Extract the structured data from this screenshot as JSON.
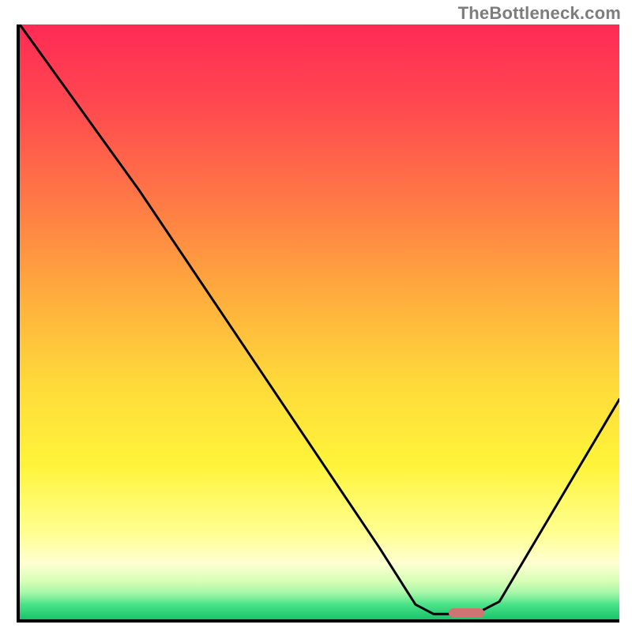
{
  "watermark": "TheBottleneck.com",
  "accent_marker_color": "#cf7373",
  "chart_data": {
    "type": "line",
    "title": "",
    "xlabel": "",
    "ylabel": "",
    "xlim": [
      0,
      100
    ],
    "ylim": [
      0,
      100
    ],
    "gradient_bands": [
      {
        "stop": 0.0,
        "color": "#ff2a55"
      },
      {
        "stop": 0.14,
        "color": "#ff4a4f"
      },
      {
        "stop": 0.3,
        "color": "#ff7a45"
      },
      {
        "stop": 0.46,
        "color": "#ffae3d"
      },
      {
        "stop": 0.6,
        "color": "#ffd93a"
      },
      {
        "stop": 0.74,
        "color": "#fff43a"
      },
      {
        "stop": 0.855,
        "color": "#ffff91"
      },
      {
        "stop": 0.905,
        "color": "#ffffd2"
      },
      {
        "stop": 0.935,
        "color": "#d8ffb8"
      },
      {
        "stop": 0.955,
        "color": "#a8f7a8"
      },
      {
        "stop": 0.975,
        "color": "#4be389"
      },
      {
        "stop": 1.0,
        "color": "#17c36a"
      }
    ],
    "curve": [
      {
        "x": 0.0,
        "y": 100.0
      },
      {
        "x": 20.0,
        "y": 72.0
      },
      {
        "x": 24.0,
        "y": 66.0
      },
      {
        "x": 40.0,
        "y": 42.0
      },
      {
        "x": 60.0,
        "y": 12.0
      },
      {
        "x": 66.0,
        "y": 2.5
      },
      {
        "x": 69.0,
        "y": 0.9
      },
      {
        "x": 76.0,
        "y": 0.9
      },
      {
        "x": 80.0,
        "y": 3.0
      },
      {
        "x": 100.0,
        "y": 37.0
      }
    ],
    "bottleneck_marker": {
      "x_start": 71.5,
      "x_end": 77.5,
      "y": 1.0
    }
  }
}
